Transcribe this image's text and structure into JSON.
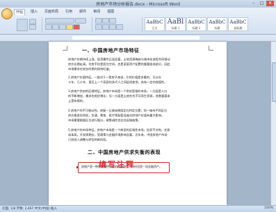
{
  "window": {
    "title": "房地产市场分析报告.docx - Microsoft Word",
    "minimize": "–",
    "maximize": "□",
    "close": "✕"
  },
  "ribbon": {
    "tabs": [
      "开始",
      "插入",
      "页面布局",
      "引用",
      "邮件",
      "审阅",
      "视图"
    ],
    "active_tab": 0,
    "styles": [
      {
        "preview": "AaBbC",
        "label": "正文"
      },
      {
        "preview": "AaBl",
        "label": "标题 1"
      },
      {
        "preview": "AaBbC",
        "label": "标题 2"
      },
      {
        "preview": "AaBbC",
        "label": "标题"
      },
      {
        "preview": "AaBbC",
        "label": "副标题"
      }
    ]
  },
  "document": {
    "heading1": "一、中国房地产市场特征",
    "paragraphs": [
      [
        "房地产价格持续上涨，投资属性日益显著，土地资源稀缺与城市化进程共同推动",
        "房价长期走高。住房不仅是居住空间，也是家庭资产配置的重要组成部分，因此",
        "市场需求在较长时期内保持旺盛。"
      ],
      [
        "2.房地产价值特征。一般对于一套房子来说，它的价值是多重的，可以在",
        "十年、几十年、甚至上一个家庭的多代人之间延续使用，具有一定的保值性。"
      ],
      [
        "3.房地产供给的区域特征。房地产市场是一个供给受限的市场，一方面是人口",
        "的不断增加，需求也相应增长；另一方面是土地作为不可再生资源，其数量基本",
        "上是有限的。"
      ],
      [
        "4.房地产的不可移动性。房屋一旦建成便固定在特定位置，同一城市不同区位",
        "的价格差异明显，交通、教育、医疗等配套设施对房地产价值有重大影响，",
        "市场需要根据区位进行细分，政策调控也往往因城施策。"
      ],
      [
        "5.房地产的市场特征。房地产市场是一个典型的区域性市场，信息不对称，交易",
        "成本高，开发周期长，受政策与金融环境影响显著，近年来，中国房地产市场",
        "已经进入调整与转型的新阶段。"
      ]
    ],
    "heading2": "二、中国房地产供求失衡的表现",
    "comment": "房地产是一种需求刚性较强的特殊商品，同时也是一项金融资产。"
  },
  "annotation_label": "编写注释",
  "status": {
    "text": "页面: 1/8   字数: 2,467   中文(中国)   插入",
    "zoom": "100%"
  }
}
